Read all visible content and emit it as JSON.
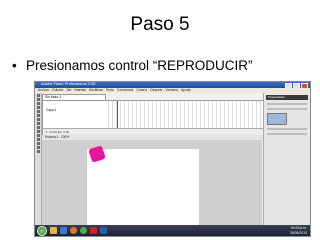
{
  "slide": {
    "title": "Paso 5",
    "bullet": "Presionamos control “REPRODUCIR”"
  },
  "app": {
    "window_title": "Adobe Flash Professional CS5",
    "menu": [
      "Archivo",
      "Edición",
      "Ver",
      "Insertar",
      "Modificar",
      "Texto",
      "Comandos",
      "Control",
      "Depurar",
      "Ventana",
      "Ayuda"
    ],
    "document_tab": "Sin título-1",
    "timeline": {
      "layer_label": "Capa 1",
      "fps": "24.00 fps",
      "frame": "1",
      "time": "0.0s"
    },
    "edit_bar": "Escena 1",
    "zoom": "100%",
    "panel_header": "Propiedades"
  },
  "colors": {
    "shape": "#e8149c",
    "titlebar": "#2a5db8",
    "taskbar": "#1c2133"
  },
  "taskbar": {
    "time": "04:33 p.m.",
    "date": "30/06/2013",
    "icons": [
      "start-orb",
      "explorer-icon",
      "media-icon",
      "firefox-icon",
      "chrome-icon",
      "flash-icon",
      "word-icon"
    ]
  }
}
